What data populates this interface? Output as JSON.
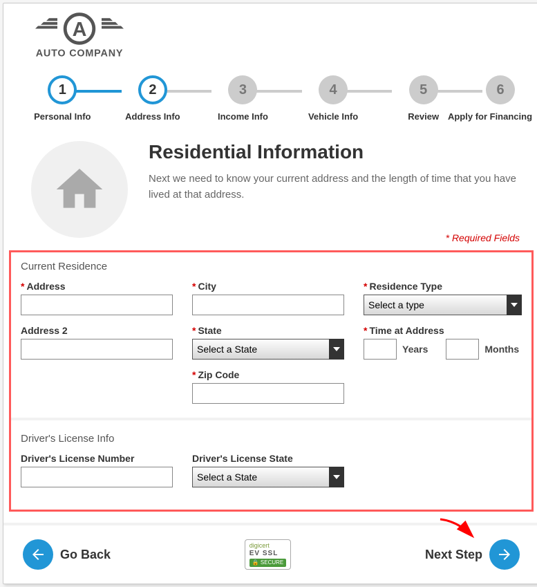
{
  "logo": {
    "name": "AUTO COMPANY"
  },
  "stepper": {
    "steps": [
      {
        "num": "1",
        "label": "Personal Info",
        "state": "done"
      },
      {
        "num": "2",
        "label": "Address Info",
        "state": "active"
      },
      {
        "num": "3",
        "label": "Income Info",
        "state": "pending"
      },
      {
        "num": "4",
        "label": "Vehicle Info",
        "state": "pending"
      },
      {
        "num": "5",
        "label": "Review",
        "state": "pending"
      },
      {
        "num": "6",
        "label": "Apply for Financing",
        "state": "pending"
      }
    ]
  },
  "header": {
    "title": "Residential Information",
    "subtitle": "Next we need to know your current address and the length of time that you have lived at that address.",
    "required_note": "* Required Fields"
  },
  "form": {
    "section1_title": "Current Residence",
    "address_label": "Address",
    "address2_label": "Address 2",
    "city_label": "City",
    "state_label": "State",
    "state_placeholder": "Select a State",
    "zip_label": "Zip Code",
    "residence_type_label": "Residence Type",
    "residence_type_placeholder": "Select a type",
    "time_label": "Time at Address",
    "years_label": "Years",
    "months_label": "Months",
    "section2_title": "Driver's License Info",
    "dl_number_label": "Driver's License Number",
    "dl_state_label": "Driver's License State",
    "dl_state_placeholder": "Select a State"
  },
  "nav": {
    "back_label": "Go Back",
    "next_label": "Next Step"
  },
  "badge": {
    "row1": "digicert",
    "row2": "EV SSL",
    "row3": "🔒 SECURE"
  }
}
